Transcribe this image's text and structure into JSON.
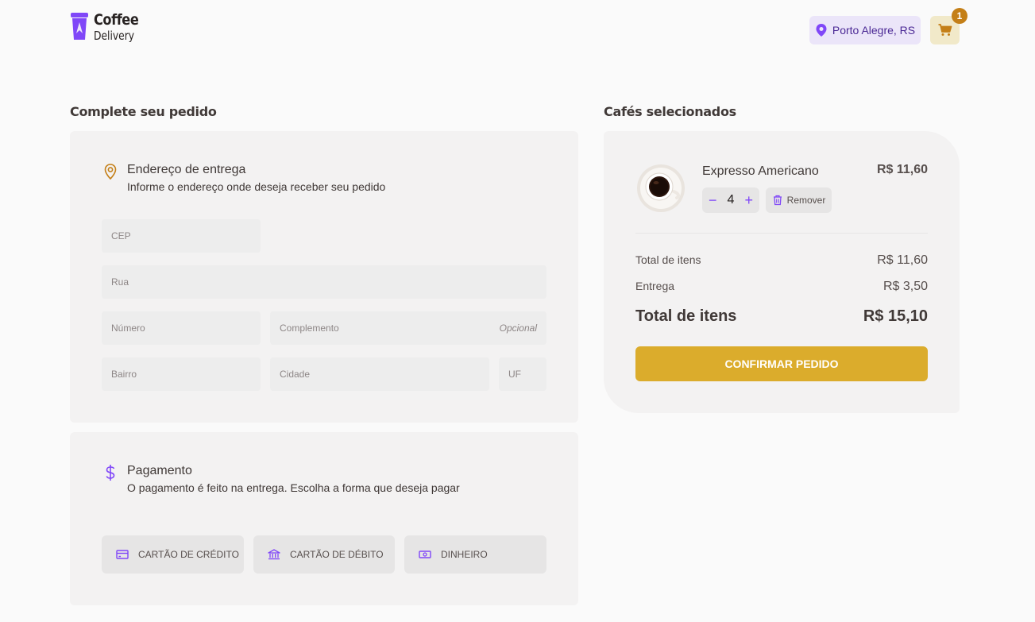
{
  "header": {
    "logo_line1": "Coffee",
    "logo_line2": "Delivery",
    "location": "Porto Alegre, RS",
    "cart_count": "1"
  },
  "order_form": {
    "title": "Complete seu pedido",
    "address": {
      "title": "Endereço de entrega",
      "subtitle": "Informe o endereço onde deseja receber seu pedido",
      "placeholders": {
        "cep": "CEP",
        "rua": "Rua",
        "numero": "Número",
        "complemento": "Complemento",
        "complemento_hint": "Opcional",
        "bairro": "Bairro",
        "cidade": "Cidade",
        "uf": "UF"
      }
    },
    "payment": {
      "title": "Pagamento",
      "subtitle": "O pagamento é feito na entrega. Escolha a forma que deseja pagar",
      "options": [
        "Cartão de crédito",
        "Cartão de débito",
        "Dinheiro"
      ]
    }
  },
  "cart": {
    "title": "Cafés selecionados",
    "items": [
      {
        "name": "Expresso Americano",
        "price": "R$ 11,60",
        "quantity": "4",
        "remove_label": "Remover"
      }
    ],
    "summary": {
      "items_label": "Total de itens",
      "items_value": "R$ 11,60",
      "delivery_label": "Entrega",
      "delivery_value": "R$ 3,50",
      "total_label": "Total de itens",
      "total_value": "R$ 15,10"
    },
    "confirm_label": "Confirmar pedido"
  },
  "colors": {
    "purple": "#8047F8",
    "purple_light": "#EBE5F9",
    "yellow": "#DBAC2C",
    "yellow_dark": "#C47F17",
    "yellow_light": "#F1E9C9"
  }
}
